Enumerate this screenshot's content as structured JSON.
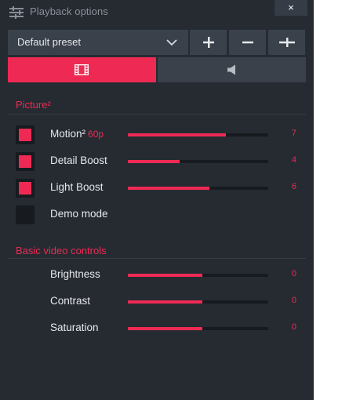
{
  "window": {
    "title": "Playback options",
    "close_label": "×"
  },
  "preset": {
    "selected": "Default preset",
    "add_label": "+",
    "remove_label": "−",
    "adjust_label": "-|-"
  },
  "tabs": [
    {
      "id": "picture",
      "icon": "film-icon",
      "active": true
    },
    {
      "id": "audio",
      "icon": "speaker-icon",
      "active": false
    }
  ],
  "picture": {
    "title": "Picture²",
    "items": [
      {
        "label": "Motion²",
        "accent": "60p",
        "checked": true,
        "value": "7",
        "level": 0.7
      },
      {
        "label": "Detail Boost",
        "checked": true,
        "value": "4",
        "level": 0.37
      },
      {
        "label": "Light Boost",
        "checked": true,
        "value": "6",
        "level": 0.58
      },
      {
        "label": "Demo mode",
        "checked": false
      }
    ]
  },
  "basic": {
    "title": "Basic video controls",
    "items": [
      {
        "label": "Brightness",
        "value": "0",
        "level": 0.53
      },
      {
        "label": "Contrast",
        "value": "0",
        "level": 0.53
      },
      {
        "label": "Saturation",
        "value": "0",
        "level": 0.53
      }
    ]
  },
  "colors": {
    "accent": "#ee2a54",
    "panel": "#262b32",
    "control": "#3a414b",
    "track": "#171a1e"
  }
}
